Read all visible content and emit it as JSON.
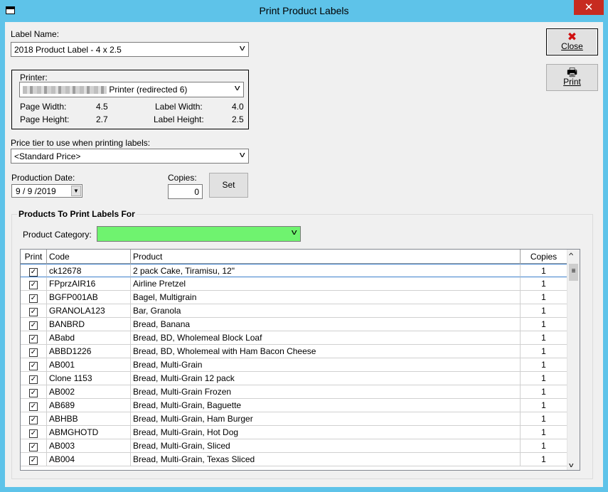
{
  "window": {
    "title": "Print Product Labels",
    "close_glyph": "✕"
  },
  "label_name": {
    "label": "Label Name:",
    "value": "2018 Product Label - 4 x 2.5"
  },
  "printer": {
    "label": "Printer:",
    "value_suffix": "Printer (redirected 6)",
    "page_width_label": "Page Width:",
    "page_width": "4.5",
    "page_height_label": "Page Height:",
    "page_height": "2.7",
    "label_width_label": "Label Width:",
    "label_width": "4.0",
    "label_height_label": "Label Height:",
    "label_height": "2.5"
  },
  "price_tier": {
    "label": "Price tier to use when printing labels:",
    "value": "<Standard Price>"
  },
  "production_date": {
    "label": "Production Date:",
    "value": "9 / 9 /2019"
  },
  "copies": {
    "label": "Copies:",
    "value": "0"
  },
  "buttons": {
    "set": "Set",
    "close": "Close",
    "print": "Print"
  },
  "products": {
    "group_title": "Products To Print Labels For",
    "category_label": "Product Category:",
    "category_value": "",
    "category_color": "#6ff36f",
    "columns": [
      "Print",
      "Code",
      "Product",
      "Copies"
    ],
    "rows": [
      {
        "checked": true,
        "code": "ck12678",
        "product": "2 pack Cake, Tiramisu, 12\"",
        "copies": "1"
      },
      {
        "checked": true,
        "code": "FPprzAIR16",
        "product": "Airline Pretzel",
        "copies": "1"
      },
      {
        "checked": true,
        "code": "BGFP001AB",
        "product": "Bagel, Multigrain",
        "copies": "1"
      },
      {
        "checked": true,
        "code": "GRANOLA123",
        "product": "Bar, Granola",
        "copies": "1"
      },
      {
        "checked": true,
        "code": "BANBRD",
        "product": "Bread, Banana",
        "copies": "1"
      },
      {
        "checked": true,
        "code": "ABabd",
        "product": "Bread, BD, Wholemeal Block Loaf",
        "copies": "1"
      },
      {
        "checked": true,
        "code": "ABBD1226",
        "product": "Bread, BD, Wholemeal with Ham Bacon Cheese",
        "copies": "1"
      },
      {
        "checked": true,
        "code": "AB001",
        "product": "Bread, Multi-Grain",
        "copies": "1"
      },
      {
        "checked": true,
        "code": "Clone 1153",
        "product": "Bread, Multi-Grain 12 pack",
        "copies": "1"
      },
      {
        "checked": true,
        "code": "AB002",
        "product": "Bread, Multi-Grain Frozen",
        "copies": "1"
      },
      {
        "checked": true,
        "code": "AB689",
        "product": "Bread, Multi-Grain, Baguette",
        "copies": "1"
      },
      {
        "checked": true,
        "code": "ABHBB",
        "product": "Bread, Multi-Grain, Ham Burger",
        "copies": "1"
      },
      {
        "checked": true,
        "code": "ABMGHOTD",
        "product": "Bread, Multi-Grain, Hot Dog",
        "copies": "1"
      },
      {
        "checked": true,
        "code": "AB003",
        "product": "Bread, Multi-Grain, Sliced",
        "copies": "1"
      },
      {
        "checked": true,
        "code": "AB004",
        "product": "Bread, Multi-Grain, Texas Sliced",
        "copies": "1"
      }
    ]
  },
  "icons": {
    "dropdown": "chevron-down-icon",
    "close": "close-icon",
    "print": "printer-icon",
    "checkbox": "check-icon"
  }
}
